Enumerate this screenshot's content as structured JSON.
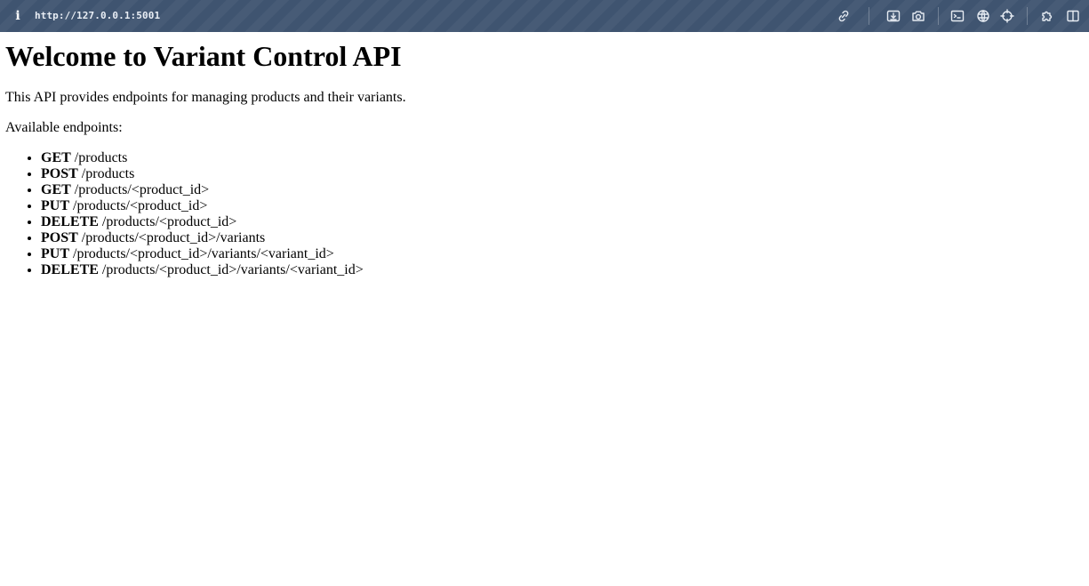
{
  "browser": {
    "info_glyph": "i",
    "url": "http://127.0.0.1:5001",
    "toolbar_icons": [
      "link-icon",
      "download-icon",
      "camera-icon",
      "terminal-icon",
      "globe-icon",
      "crosshair-icon",
      "extension-icon",
      "split-view-icon"
    ]
  },
  "page": {
    "title": "Welcome to Variant Control API",
    "intro": "This API provides endpoints for managing products and their variants.",
    "available_label": "Available endpoints:",
    "endpoints": [
      {
        "method": "GET",
        "path": "/products"
      },
      {
        "method": "POST",
        "path": "/products"
      },
      {
        "method": "GET",
        "path": "/products/<product_id>"
      },
      {
        "method": "PUT",
        "path": "/products/<product_id>"
      },
      {
        "method": "DELETE",
        "path": "/products/<product_id>"
      },
      {
        "method": "POST",
        "path": "/products/<product_id>/variants"
      },
      {
        "method": "PUT",
        "path": "/products/<product_id>/variants/<variant_id>"
      },
      {
        "method": "DELETE",
        "path": "/products/<product_id>/variants/<variant_id>"
      }
    ]
  }
}
